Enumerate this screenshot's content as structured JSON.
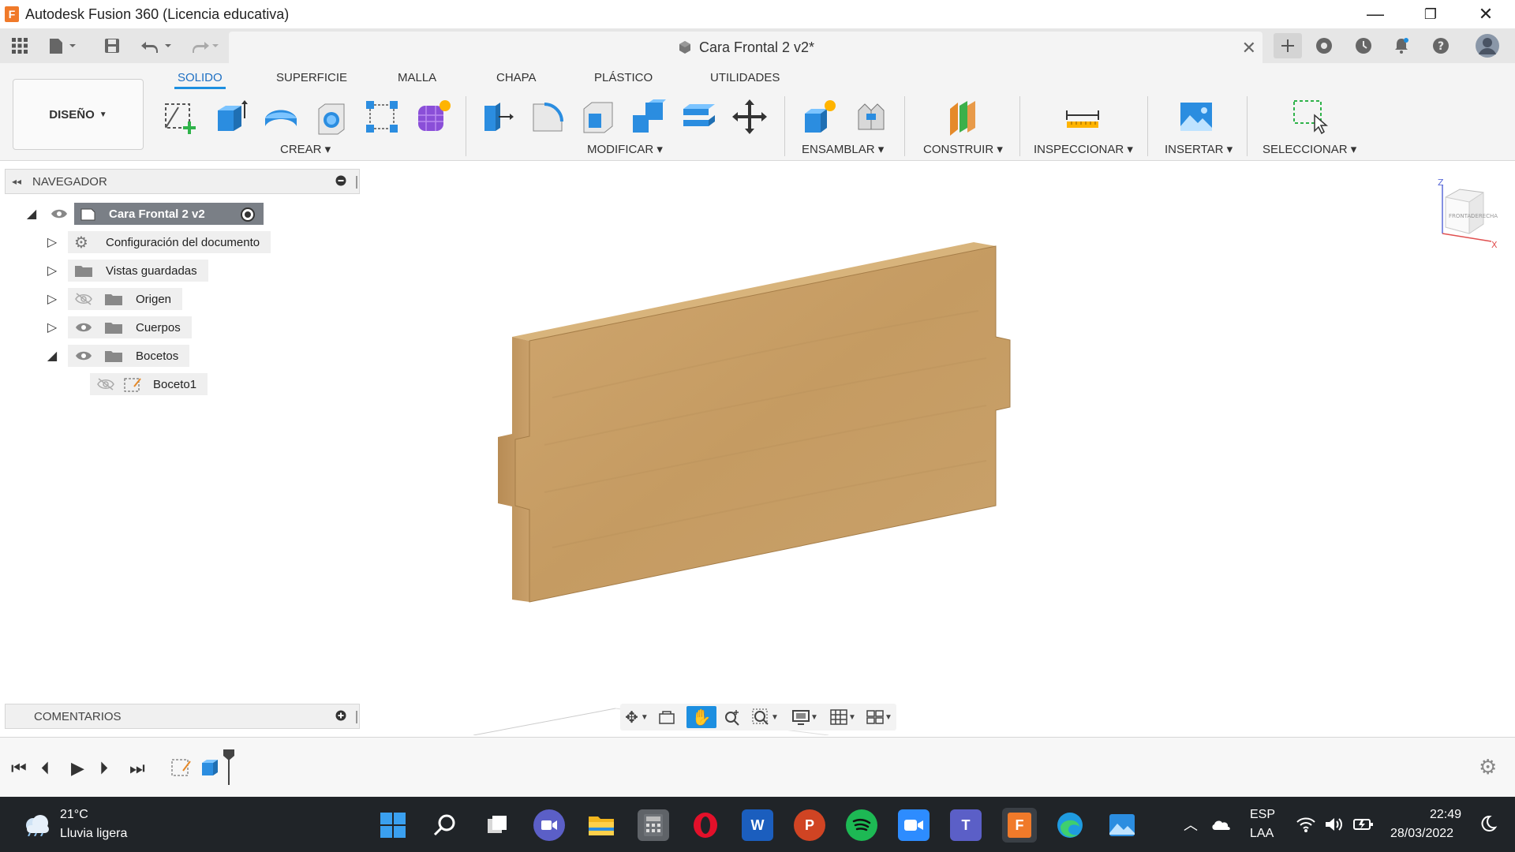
{
  "window": {
    "title": "Autodesk Fusion 360 (Licencia educativa)",
    "logo_letter": "F",
    "minimize_glyph": "—",
    "restore_glyph": "❐",
    "close_glyph": "✕"
  },
  "document_tab": {
    "title": "Cara Frontal 2 v2*"
  },
  "toolbar": {
    "workspace_label": "DISEÑO",
    "tabs": [
      {
        "label": "SOLIDO",
        "active": true
      },
      {
        "label": "SUPERFICIE",
        "active": false
      },
      {
        "label": "MALLA",
        "active": false
      },
      {
        "label": "CHAPA",
        "active": false
      },
      {
        "label": "PLÁSTICO",
        "active": false
      },
      {
        "label": "UTILIDADES",
        "active": false
      }
    ],
    "groups": {
      "crear": "CREAR",
      "modificar": "MODIFICAR",
      "ensamblar": "ENSAMBLAR",
      "construir": "CONSTRUIR",
      "inspeccionar": "INSPECCIONAR",
      "insertar": "INSERTAR",
      "seleccionar": "SELECCIONAR"
    }
  },
  "navigator": {
    "header": "NAVEGADOR",
    "root": "Cara Frontal 2 v2",
    "items": [
      {
        "label": "Configuración del documento"
      },
      {
        "label": "Vistas guardadas"
      },
      {
        "label": "Origen"
      },
      {
        "label": "Cuerpos"
      },
      {
        "label": "Bocetos"
      },
      {
        "label": "Boceto1"
      }
    ]
  },
  "comments": {
    "header": "COMENTARIOS"
  },
  "viewcube": {
    "axis_z": "Z",
    "axis_x": "X",
    "front": "FRONTAL",
    "right": "DERECHA"
  },
  "taskbar": {
    "weather_temp": "21°C",
    "weather_desc": "Lluvia ligera",
    "lang_top": "ESP",
    "lang_bottom": "LAA",
    "time": "22:49",
    "date": "28/03/2022"
  },
  "colors": {
    "accent": "#1d8fe0",
    "wood": "#c9a06a",
    "fusion_orange": "#f07a2a"
  }
}
